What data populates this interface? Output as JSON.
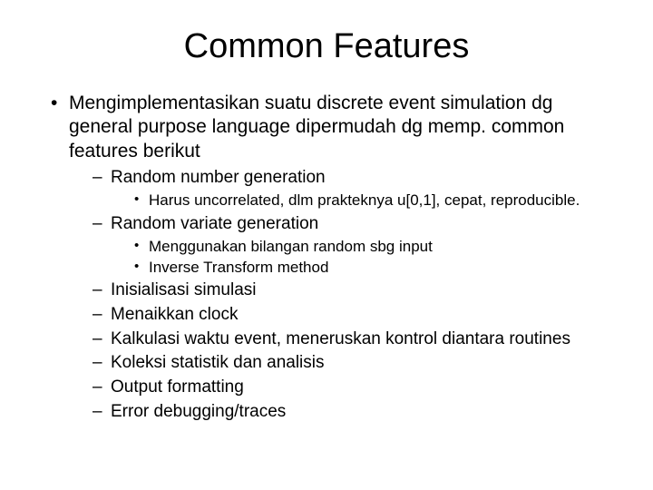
{
  "title": "Common Features",
  "b1": "Mengimplementasikan suatu discrete event simulation dg general purpose language dipermudah dg memp. common features berikut",
  "l2_0": "Random number generation",
  "l3_0_0": "Harus uncorrelated, dlm prakteknya u[0,1], cepat, reproducible.",
  "l2_1": "Random variate generation",
  "l3_1_0": "Menggunakan bilangan random sbg input",
  "l3_1_1": "Inverse Transform method",
  "l2_2": "Inisialisasi simulasi",
  "l2_3": "Menaikkan clock",
  "l2_4": "Kalkulasi waktu event, meneruskan kontrol diantara routines",
  "l2_5": "Koleksi statistik dan analisis",
  "l2_6": "Output formatting",
  "l2_7": "Error debugging/traces"
}
